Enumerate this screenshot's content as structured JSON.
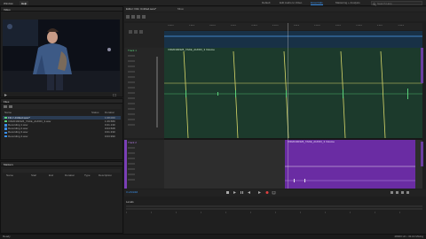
{
  "topbar": {
    "menu": [
      "Window",
      "Help"
    ],
    "workspaces": [
      "Default",
      "Edit Audio to Video",
      "Essentials",
      "Mastering + Analysis",
      "Multitrack",
      "Podcast",
      "Radio Production",
      "Restoration"
    ],
    "active_workspace": "Essentials",
    "search_placeholder": "Search Help"
  },
  "left": {
    "video_panel_title": "Video",
    "files_panel_title": "Files",
    "files_columns": [
      "Name",
      "Status",
      "Duration"
    ],
    "files": [
      {
        "name": "Film Untitled.sesx*",
        "duration": "1:08.000"
      },
      {
        "name": "VID20190326_TAKE_AUDIO_3.wav",
        "duration": "1:29.580"
      },
      {
        "name": "Recording 1.wav",
        "duration": "0:21.130"
      },
      {
        "name": "Recording 2.wav",
        "duration": "0:04.508"
      },
      {
        "name": "Recording 3.wav",
        "duration": "0:01.330"
      },
      {
        "name": "Recording 4.wav",
        "duration": "0:03.990"
      }
    ],
    "markers_panel_title": "Markers",
    "markers_columns": [
      "Name",
      "Start",
      "End",
      "Duration",
      "Type",
      "Description"
    ]
  },
  "editor": {
    "tab_label": "Editor: Film Untitled.sesx*",
    "mixer_label": "Mixer",
    "ruler_ticks": [
      "0:00.0",
      "0:10.0",
      "0:20.0",
      "0:30.0",
      "0:40.0",
      "0:50.0",
      "1:00.0",
      "1:10.0",
      "1:20.0",
      "1:30.0",
      "1:40.0",
      "1:50.0"
    ],
    "track1_name": "Track 1",
    "track1_clip": "VID20190326_TAKE_AUDIO_3 Volume",
    "track2_name": "Track 2",
    "track2_clip": "VID20190326_TAKE_AUDIO_3 Volume",
    "current_time": "0:25.648",
    "levels_label": "Levels"
  },
  "status": {
    "left_text": "Ready",
    "right_text": "48000 Hz • 32-bit Mixing"
  },
  "colors": {
    "track_green": "#1c3a2c",
    "clip_purple": "#6a2ca3",
    "accent_blue": "#3a8fe8",
    "waveform_green": "#5ad07a",
    "envelope_yellow": "#d9d96a"
  }
}
